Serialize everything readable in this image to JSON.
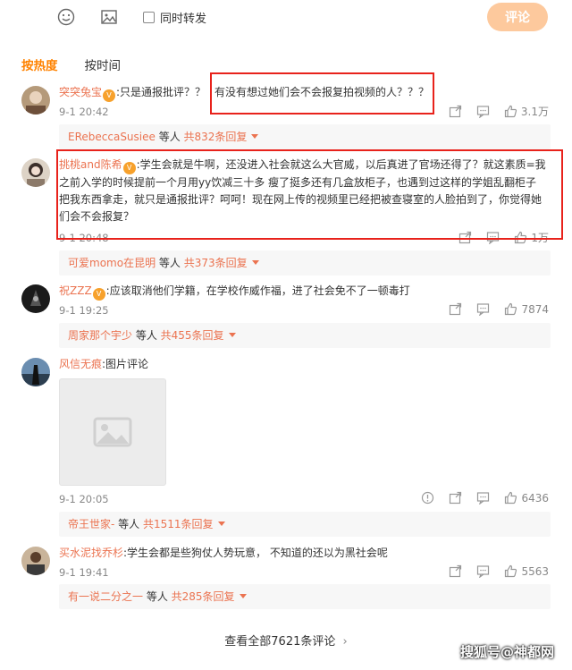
{
  "toolbar": {
    "repost_label": "同时转发",
    "submit_label": "评论"
  },
  "tabs": [
    {
      "label": "按热度"
    },
    {
      "label": "按时间"
    }
  ],
  "comments": [
    {
      "user": "突突兔宝",
      "text": ":只是通报批评？？",
      "highlight": "有没有想过她们会不会报复拍视频的人？？？",
      "time": "9-1 20:42",
      "likes": "3.1万",
      "reply_user": "ERebeccaSusiee",
      "reply_mid": " 等人 ",
      "reply_count": "共832条回复"
    },
    {
      "user": "挑桃and陈希",
      "text": ":学生会就是牛啊，还没进入社会就这么大官威，以后真进了官场还得了？就这素质=我之前入学的时候提前一个月用yy饮减三十多 瘦了挺多还有几盒放柜子，也遇到过这样的学姐乱翻柜子把我东西拿走，就只是通报批评？呵呵！现在网上传的视频里已经把被查寝室的人脸拍到了，你觉得她们会不会报复？",
      "time": "9-1 20:48",
      "likes": "1万",
      "reply_user": "可爱momo在昆明",
      "reply_mid": " 等人 ",
      "reply_count": "共373条回复"
    },
    {
      "user": "祝ZZZ",
      "text": ":应该取消他们学籍，在学校作威作福，进了社会免不了一顿毒打",
      "time": "9-1 19:25",
      "likes": "7874",
      "reply_user": "周家那个宇少",
      "reply_mid": " 等人 ",
      "reply_count": "共455条回复"
    },
    {
      "user": "风信无痕",
      "text": ":图片评论",
      "time": "9-1 20:05",
      "likes": "6436",
      "reply_user": "帝王世家-",
      "reply_mid": " 等人 ",
      "reply_count": "共1511条回复"
    },
    {
      "user": "买水泥找乔杉",
      "text": ":学生会都是些狗仗人势玩意， 不知道的还以为黑社会呢",
      "time": "9-1 19:41",
      "likes": "5563",
      "reply_user": "有一说二分之一",
      "reply_mid": " 等人 ",
      "reply_count": "共285条回复"
    }
  ],
  "view_all": "查看全部7621条评论",
  "watermark": "搜狐号@神都网",
  "colors": {
    "accent": "#ff8200",
    "username": "#eb7350",
    "highlight_box": "#e8221b",
    "submit_bg": "#fdc99d"
  },
  "icons": [
    "emoji-icon",
    "image-icon",
    "repost-icon",
    "comment-icon",
    "like-icon",
    "chevron-right-icon"
  ]
}
